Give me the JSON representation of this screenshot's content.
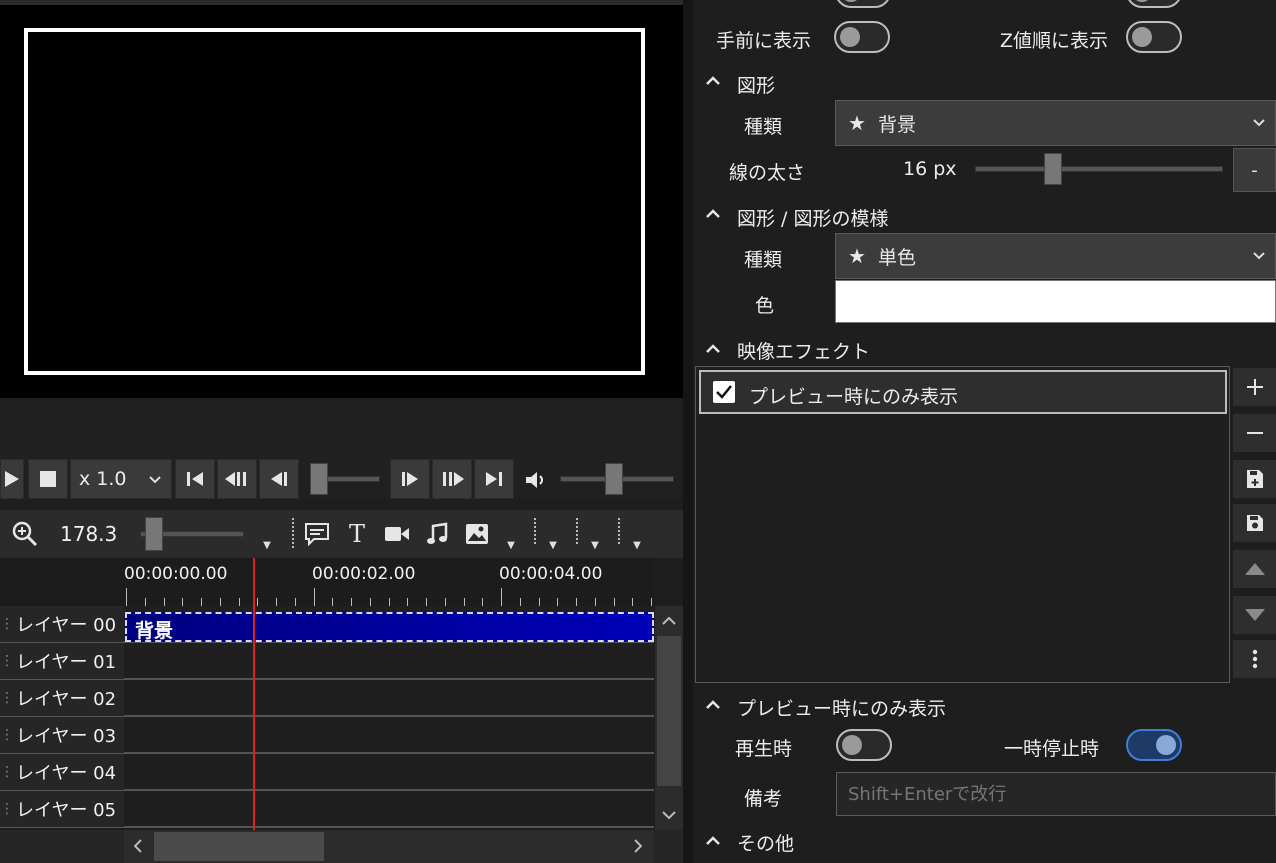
{
  "playback": {
    "speed": "x 1.0"
  },
  "timeline": {
    "zoom_value": "178.3",
    "timecodes": [
      "00:00:00.00",
      "00:00:02.00",
      "00:00:04.00"
    ],
    "layers": [
      "レイヤー 00",
      "レイヤー 01",
      "レイヤー 02",
      "レイヤー 03",
      "レイヤー 04",
      "レイヤー 05"
    ],
    "clip_label": "背景",
    "clip_color": "#0000a8",
    "playhead_color": "#e02020"
  },
  "properties": {
    "front_label": "手前に表示",
    "zorder_label": "Z値順に表示",
    "shape_section": "図形",
    "kind_label": "種類",
    "shape_kind_value": "背景",
    "line_width_label": "線の太さ",
    "line_width_value": "16 px",
    "line_width_minus": "-",
    "pattern_section": "図形 / 図形の模様",
    "pattern_kind_label": "種類",
    "pattern_kind_value": "単色",
    "color_label": "色",
    "color_value": "#ffffff",
    "effects_section": "映像エフェクト",
    "effect_item": "プレビュー時にのみ表示",
    "preview_section": "プレビュー時にのみ表示",
    "play_label": "再生時",
    "pause_label": "一時停止時",
    "memo_label": "備考",
    "memo_placeholder": "Shift+Enterで改行",
    "other_section": "その他"
  }
}
